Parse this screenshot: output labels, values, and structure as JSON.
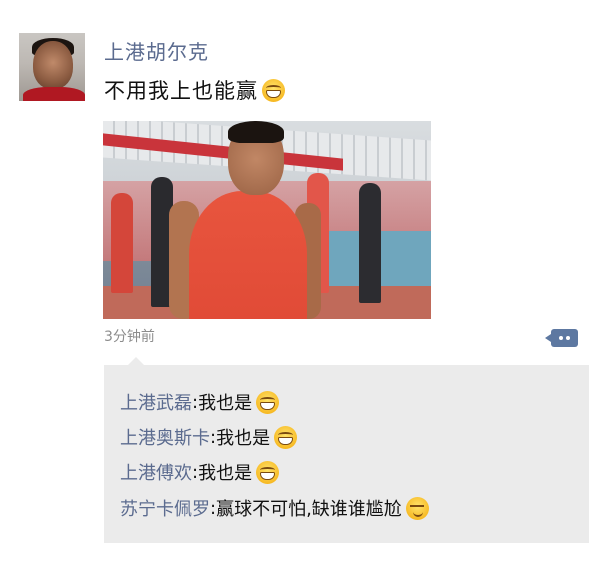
{
  "post": {
    "username": "上港胡尔克",
    "text": "不用我上也能赢",
    "emoji": "grin-emoji",
    "timestamp": "3分钟前"
  },
  "comments": [
    {
      "author": "上港武磊",
      "sep": ": ",
      "text": "我也是",
      "emoji": "grin-emoji"
    },
    {
      "author": "上港奥斯卡",
      "sep": ": ",
      "text": "我也是",
      "emoji": "grin-emoji"
    },
    {
      "author": "上港傅欢",
      "sep": ": ",
      "text": "我也是",
      "emoji": "grin-emoji"
    },
    {
      "author": "苏宁卡佩罗",
      "sep": ": ",
      "text": "赢球不可怕,缺谁谁尴尬",
      "emoji": "smirk-emoji"
    }
  ],
  "colors": {
    "name_blue": "#5b6b8f",
    "comment_bg": "#ebebeb",
    "action_btn": "#5d78a1"
  }
}
